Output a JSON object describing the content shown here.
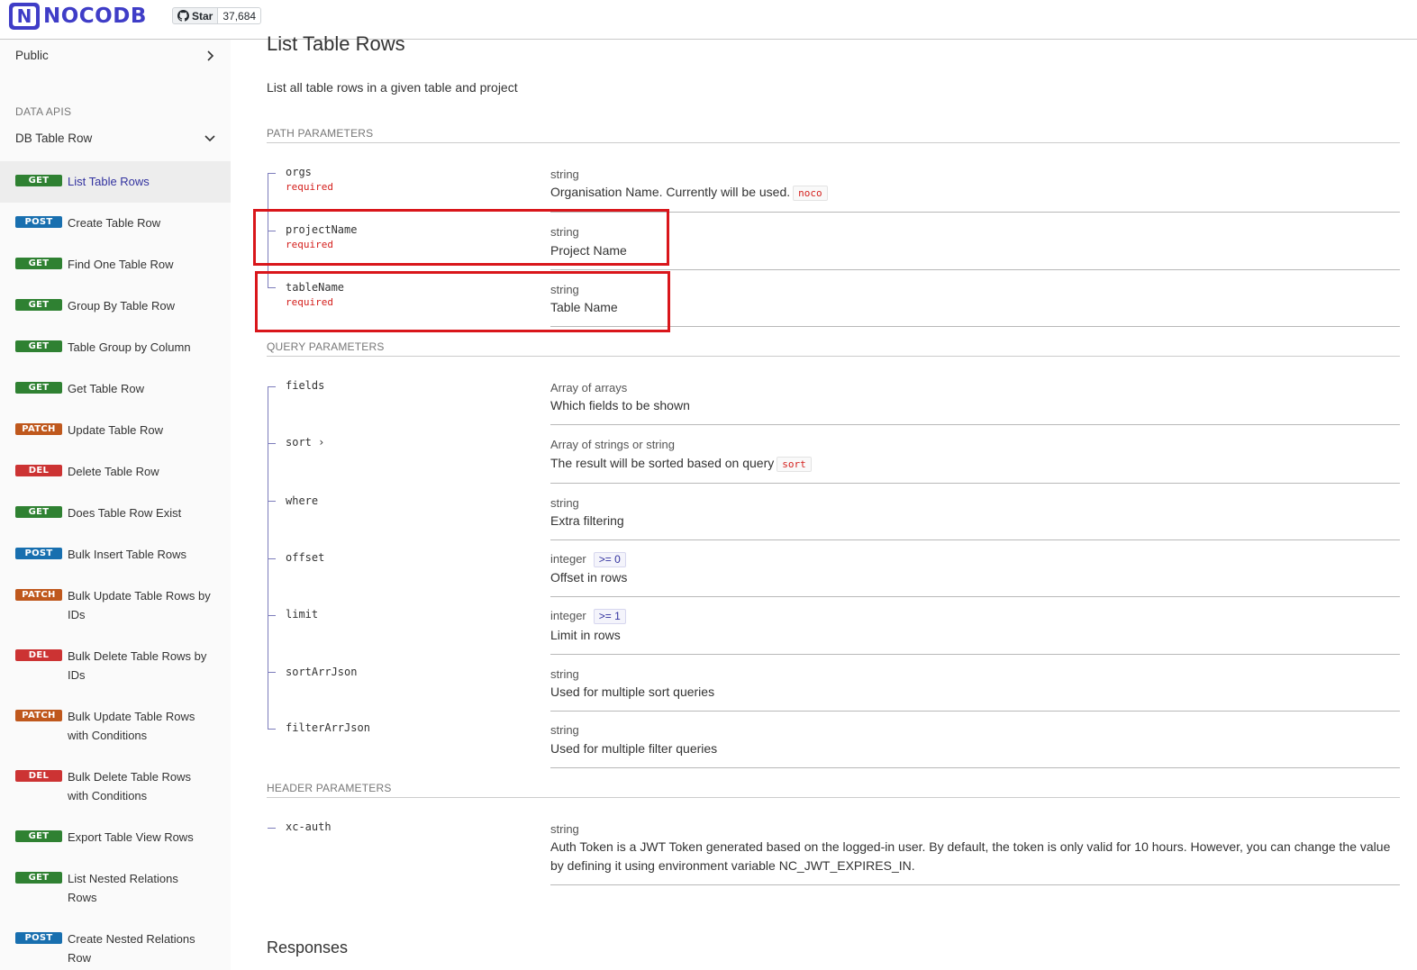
{
  "header": {
    "logo_letter": "N",
    "logo_text": "NOCODB",
    "github_star_label": "Star",
    "github_star_count": "37,684"
  },
  "sidebar": {
    "public_label": "Public",
    "section_label": "DATA APIS",
    "group_label": "DB Table Row",
    "items": [
      {
        "method": "GET",
        "label": "List Table Rows"
      },
      {
        "method": "POST",
        "label": "Create Table Row"
      },
      {
        "method": "GET",
        "label": "Find One Table Row"
      },
      {
        "method": "GET",
        "label": "Group By Table Row"
      },
      {
        "method": "GET",
        "label": "Table Group by Column"
      },
      {
        "method": "GET",
        "label": "Get Table Row"
      },
      {
        "method": "PATCH",
        "label": "Update Table Row"
      },
      {
        "method": "DEL",
        "label": "Delete Table Row"
      },
      {
        "method": "GET",
        "label": "Does Table Row Exist"
      },
      {
        "method": "POST",
        "label": "Bulk Insert Table Rows"
      },
      {
        "method": "PATCH",
        "label": "Bulk Update Table Rows by IDs"
      },
      {
        "method": "DEL",
        "label": "Bulk Delete Table Rows by IDs"
      },
      {
        "method": "PATCH",
        "label": "Bulk Update Table Rows with Conditions"
      },
      {
        "method": "DEL",
        "label": "Bulk Delete Table Rows with Conditions"
      },
      {
        "method": "GET",
        "label": "Export Table View Rows"
      },
      {
        "method": "GET",
        "label": "List Nested Relations Rows"
      },
      {
        "method": "POST",
        "label": "Create Nested Relations Row"
      }
    ]
  },
  "main": {
    "title": "List Table Rows",
    "description": "List all table rows in a given table and project",
    "path_section": "PATH PARAMETERS",
    "path_params": [
      {
        "name": "orgs",
        "required": "required",
        "type": "string",
        "desc": "Organisation Name. Currently will be used.",
        "code": "noco"
      },
      {
        "name": "projectName",
        "required": "required",
        "type": "string",
        "desc": "Project Name"
      },
      {
        "name": "tableName",
        "required": "required",
        "type": "string",
        "desc": "Table Name"
      }
    ],
    "query_section": "QUERY PARAMETERS",
    "query_params": [
      {
        "name": "fields",
        "type": "Array of arrays",
        "desc": "Which fields to be shown"
      },
      {
        "name": "sort",
        "expand": "›",
        "type": "Array of strings or string",
        "desc": "The result will be sorted based on query",
        "code": "sort"
      },
      {
        "name": "where",
        "type": "string",
        "desc": "Extra filtering"
      },
      {
        "name": "offset",
        "type": "integer",
        "constraint": ">= 0",
        "desc": "Offset in rows"
      },
      {
        "name": "limit",
        "type": "integer",
        "constraint": ">= 1",
        "desc": "Limit in rows"
      },
      {
        "name": "sortArrJson",
        "type": "string",
        "desc": "Used for multiple sort queries"
      },
      {
        "name": "filterArrJson",
        "type": "string",
        "desc": "Used for multiple filter queries"
      }
    ],
    "header_section": "HEADER PARAMETERS",
    "header_params": [
      {
        "name": "xc-auth",
        "type": "string",
        "desc": "Auth Token is a JWT Token generated based on the logged-in user. By default, the token is only valid for 10 hours. However, you can change the value by defining it using environment variable NC_JWT_EXPIRES_IN."
      }
    ],
    "responses_label": "Responses"
  },
  "colors": {
    "brand": "#3f3dc7",
    "get": "#2f8132",
    "post": "#186faf",
    "patch": "#bf581d",
    "del": "#cc3333",
    "highlight": "#d9161b"
  }
}
